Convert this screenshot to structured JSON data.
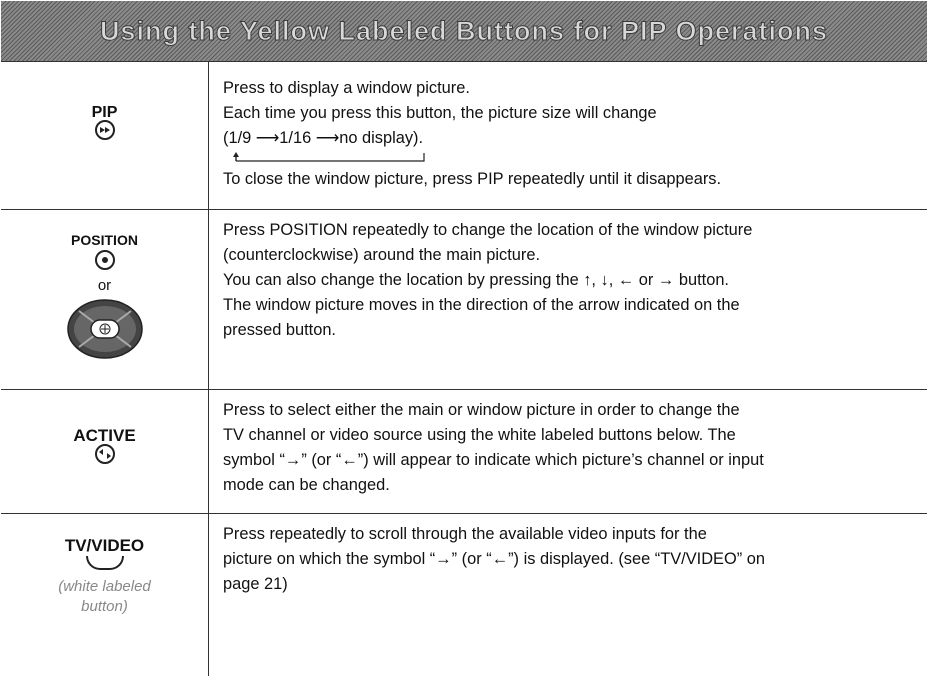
{
  "title": "Using the Yellow Labeled Buttons for PIP Operations",
  "rows": [
    {
      "button": "PIP",
      "lines": [
        "Press to display a window picture.",
        "Each time you press this button, the picture size will change",
        "(1/9 ⟶1/16 ⟶no display).",
        "To close the window picture, press PIP repeatedly until it disappears."
      ]
    },
    {
      "button": "POSITION",
      "or": "or",
      "lines": [
        "Press POSITION repeatedly to change the location of the window picture",
        "(counterclockwise) around the main picture.",
        "You can also change the location by pressing the ↑, ↓, ← or → button.",
        "The window picture moves in the direction of the arrow indicated on the",
        "pressed button."
      ]
    },
    {
      "button": "ACTIVE",
      "lines": [
        "Press to select either the main or window picture in order to change the",
        "TV channel or video source using the white labeled buttons below. The",
        "symbol “→” (or “←”) will appear to indicate which picture’s channel or input",
        "mode can be changed."
      ]
    },
    {
      "button": "TV/VIDEO",
      "note1": "(white labeled",
      "note2": "button)",
      "lines": [
        "Press repeatedly to scroll through the available video inputs for the",
        "picture on which the symbol “→” (or “←”) is displayed. (see “TV/VIDEO” on",
        "page 21)"
      ]
    }
  ]
}
